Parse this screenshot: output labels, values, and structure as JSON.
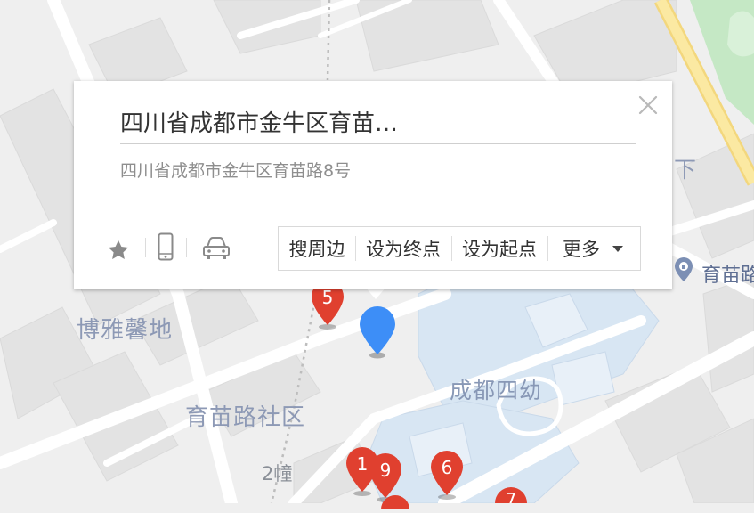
{
  "popup": {
    "title": "四川省成都市金牛区育苗…",
    "address": "四川省成都市金牛区育苗路8号",
    "actions": {
      "nearby": "搜周边",
      "set_destination": "设为终点",
      "set_origin": "设为起点",
      "more": "更多"
    },
    "icons": [
      "star-icon",
      "phone-icon",
      "car-icon",
      "close-icon"
    ]
  },
  "map": {
    "labels": {
      "boya": "博雅馨地",
      "shequ": "育苗路社区",
      "siyou": "成都四幼",
      "building": "2幢",
      "xia": "下",
      "yumiao": "育苗路"
    },
    "markers": [
      "1",
      "9",
      "5",
      "6",
      "7"
    ],
    "colors": {
      "land": "#efefef",
      "road": "#ffffff",
      "block": "#e2e2e2",
      "school_area": "#d8e6f3",
      "green": "#c5e8c5",
      "major_road": "#fbe9a2",
      "red_marker": "#e0402f",
      "blue_pin": "#3d8ef7"
    }
  }
}
